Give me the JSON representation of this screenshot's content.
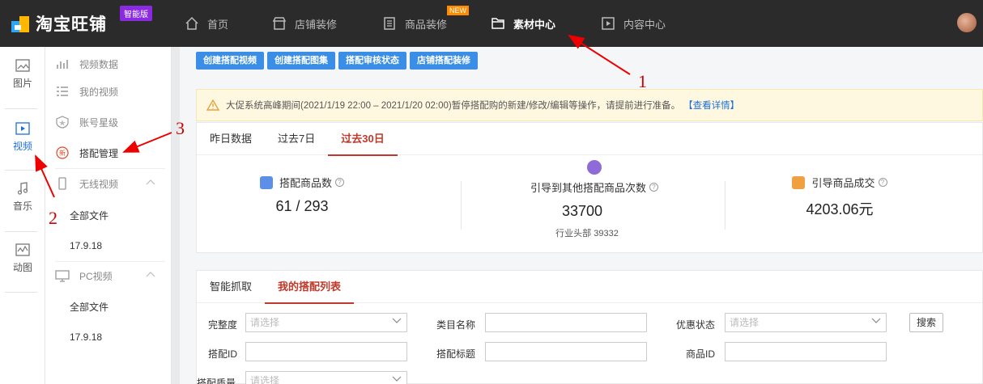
{
  "app": {
    "logo_text": "淘宝旺铺",
    "badge": "智能版"
  },
  "topnav": {
    "items": [
      {
        "label": "首页",
        "icon": "home-icon"
      },
      {
        "label": "店铺装修",
        "icon": "store-icon"
      },
      {
        "label": "商品装修",
        "icon": "document-icon",
        "badge": "NEW"
      },
      {
        "label": "素材中心",
        "icon": "folder-icon",
        "active": true
      },
      {
        "label": "内容中心",
        "icon": "play-icon"
      }
    ]
  },
  "rail": {
    "items": [
      {
        "label": "图片",
        "icon": "image-icon"
      },
      {
        "label": "视频",
        "icon": "video-icon",
        "active": true
      },
      {
        "label": "音乐",
        "icon": "music-icon"
      },
      {
        "label": "动图",
        "icon": "gif-icon"
      }
    ]
  },
  "menu": {
    "video_data": "视频数据",
    "my_videos": "我的视频",
    "account_level": "账号星级",
    "match_mgmt": "搭配管理",
    "wireless": "无线视频",
    "wireless_all": "全部文件",
    "wireless_folder": "17.9.18",
    "pc": "PC视频",
    "pc_all": "全部文件",
    "pc_folder": "17.9.18"
  },
  "actions": {
    "create_video": "创建搭配视频",
    "create_album": "创建搭配图集",
    "review_status": "搭配审核状态",
    "shop_decor": "店铺搭配装修"
  },
  "notice": {
    "text": "大促系统高峰期间(2021/1/19 22:00 – 2021/1/20 02:00)暂停搭配购的新建/修改/编辑等操作，请提前进行准备。",
    "link": "【查看详情】"
  },
  "stats_tabs": [
    "昨日数据",
    "过去7日",
    "过去30日"
  ],
  "stats": {
    "s1": {
      "label": "搭配商品数",
      "value": "61 / 293",
      "color": "#5b8fe8"
    },
    "s2": {
      "label": "引导到其他搭配商品次数",
      "value": "33700",
      "sub": "行业头部 39332",
      "color": "#8e6bd6"
    },
    "s3": {
      "label": "引导商品成交",
      "value": "4203.06元",
      "color": "#f0a040"
    }
  },
  "list_tabs": [
    "智能抓取",
    "我的搭配列表"
  ],
  "filters": {
    "completeness": "完整度",
    "category": "类目名称",
    "discount": "优惠状态",
    "match_id": "搭配ID",
    "match_title": "搭配标题",
    "item_id": "商品ID",
    "quality": "搭配质量",
    "placeholder": "请选择",
    "search": "搜索"
  },
  "annotations": [
    "1",
    "2",
    "3"
  ]
}
